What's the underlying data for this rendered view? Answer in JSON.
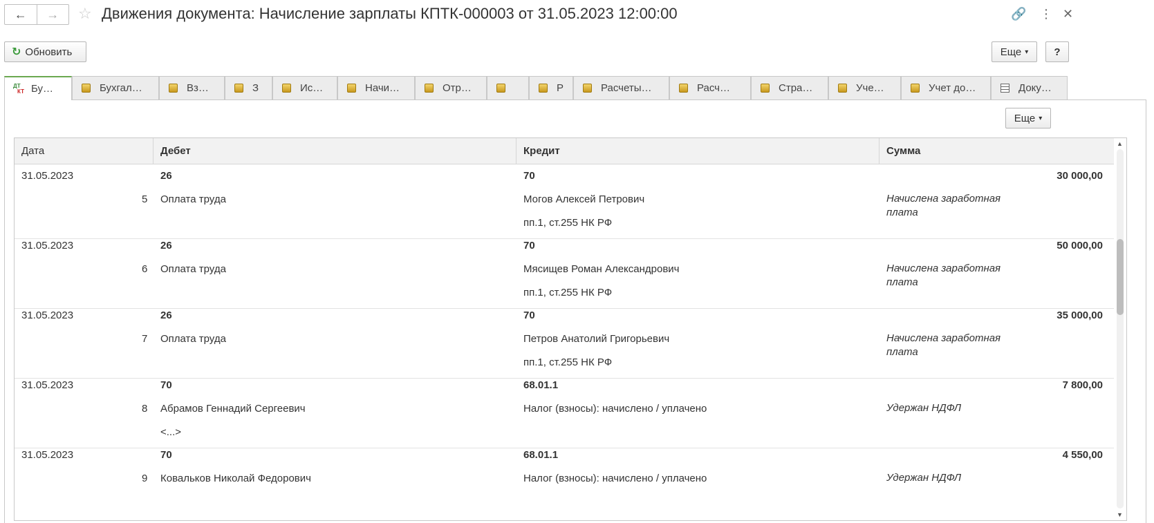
{
  "window": {
    "title": "Движения документа: Начисление зарплаты КПТК-000003 от 31.05.2023 12:00:00",
    "back_icon": "←",
    "forward_icon": "→",
    "star_icon": "☆",
    "link_icon": "🔗",
    "more_icon": "⋮",
    "close_icon": "✕"
  },
  "toolbar": {
    "refresh_label": "Обновить",
    "refresh_icon": "↻",
    "more_label": "Еще",
    "more_arrow": "▾",
    "help_label": "?"
  },
  "tabs": [
    {
      "label": "Бу…",
      "active": true,
      "icon": "dtkt"
    },
    {
      "label": "Бухгал…",
      "icon": "coin"
    },
    {
      "label": "Вз…",
      "icon": "coin"
    },
    {
      "label": "З",
      "icon": "coin"
    },
    {
      "label": "Ис…",
      "icon": "coin"
    },
    {
      "label": "Начи…",
      "icon": "coin"
    },
    {
      "label": "Отр…",
      "icon": "coin"
    },
    {
      "label": "",
      "icon": "coin"
    },
    {
      "label": "Р",
      "icon": "coin"
    },
    {
      "label": "Расчеты…",
      "icon": "coin"
    },
    {
      "label": "Расч…",
      "icon": "coin"
    },
    {
      "label": "Стра…",
      "icon": "coin"
    },
    {
      "label": "Уче…",
      "icon": "coin"
    },
    {
      "label": "Учет до…",
      "icon": "coin"
    },
    {
      "label": "Доку…",
      "icon": "grid"
    }
  ],
  "panel": {
    "more_label": "Еще",
    "more_arrow": "▾"
  },
  "table": {
    "columns": [
      "Дата",
      "Дебет",
      "Кредит",
      "Сумма"
    ],
    "rows": [
      {
        "date": "31.05.2023",
        "num": "5",
        "debit": "26",
        "debit_sub": "Оплата труда",
        "debit_sub2": "",
        "credit": "70",
        "credit_sub": "Могов Алексей Петрович",
        "credit_sub2": "пп.1, ст.255 НК РФ",
        "amount": "30 000,00",
        "note": "Начислена заработная плата"
      },
      {
        "date": "31.05.2023",
        "num": "6",
        "debit": "26",
        "debit_sub": "Оплата труда",
        "debit_sub2": "",
        "credit": "70",
        "credit_sub": "Мясищев Роман Александрович",
        "credit_sub2": "пп.1, ст.255 НК РФ",
        "amount": "50 000,00",
        "note": "Начислена заработная плата"
      },
      {
        "date": "31.05.2023",
        "num": "7",
        "debit": "26",
        "debit_sub": "Оплата труда",
        "debit_sub2": "",
        "credit": "70",
        "credit_sub": "Петров Анатолий Григорьевич",
        "credit_sub2": "пп.1, ст.255 НК РФ",
        "amount": "35 000,00",
        "note": "Начислена заработная плата"
      },
      {
        "date": "31.05.2023",
        "num": "8",
        "debit": "70",
        "debit_sub": "Абрамов Геннадий Сергеевич",
        "debit_sub2": "<...>",
        "credit": "68.01.1",
        "credit_sub": "Налог (взносы): начислено / уплачено",
        "credit_sub2": "",
        "amount": "7 800,00",
        "note": "Удержан НДФЛ"
      },
      {
        "date": "31.05.2023",
        "num": "9",
        "debit": "70",
        "debit_sub": "Ковальков Николай Федорович",
        "debit_sub2": "",
        "credit": "68.01.1",
        "credit_sub": "Налог (взносы): начислено / уплачено",
        "credit_sub2": "",
        "amount": "4 550,00",
        "note": "Удержан НДФЛ"
      }
    ]
  }
}
